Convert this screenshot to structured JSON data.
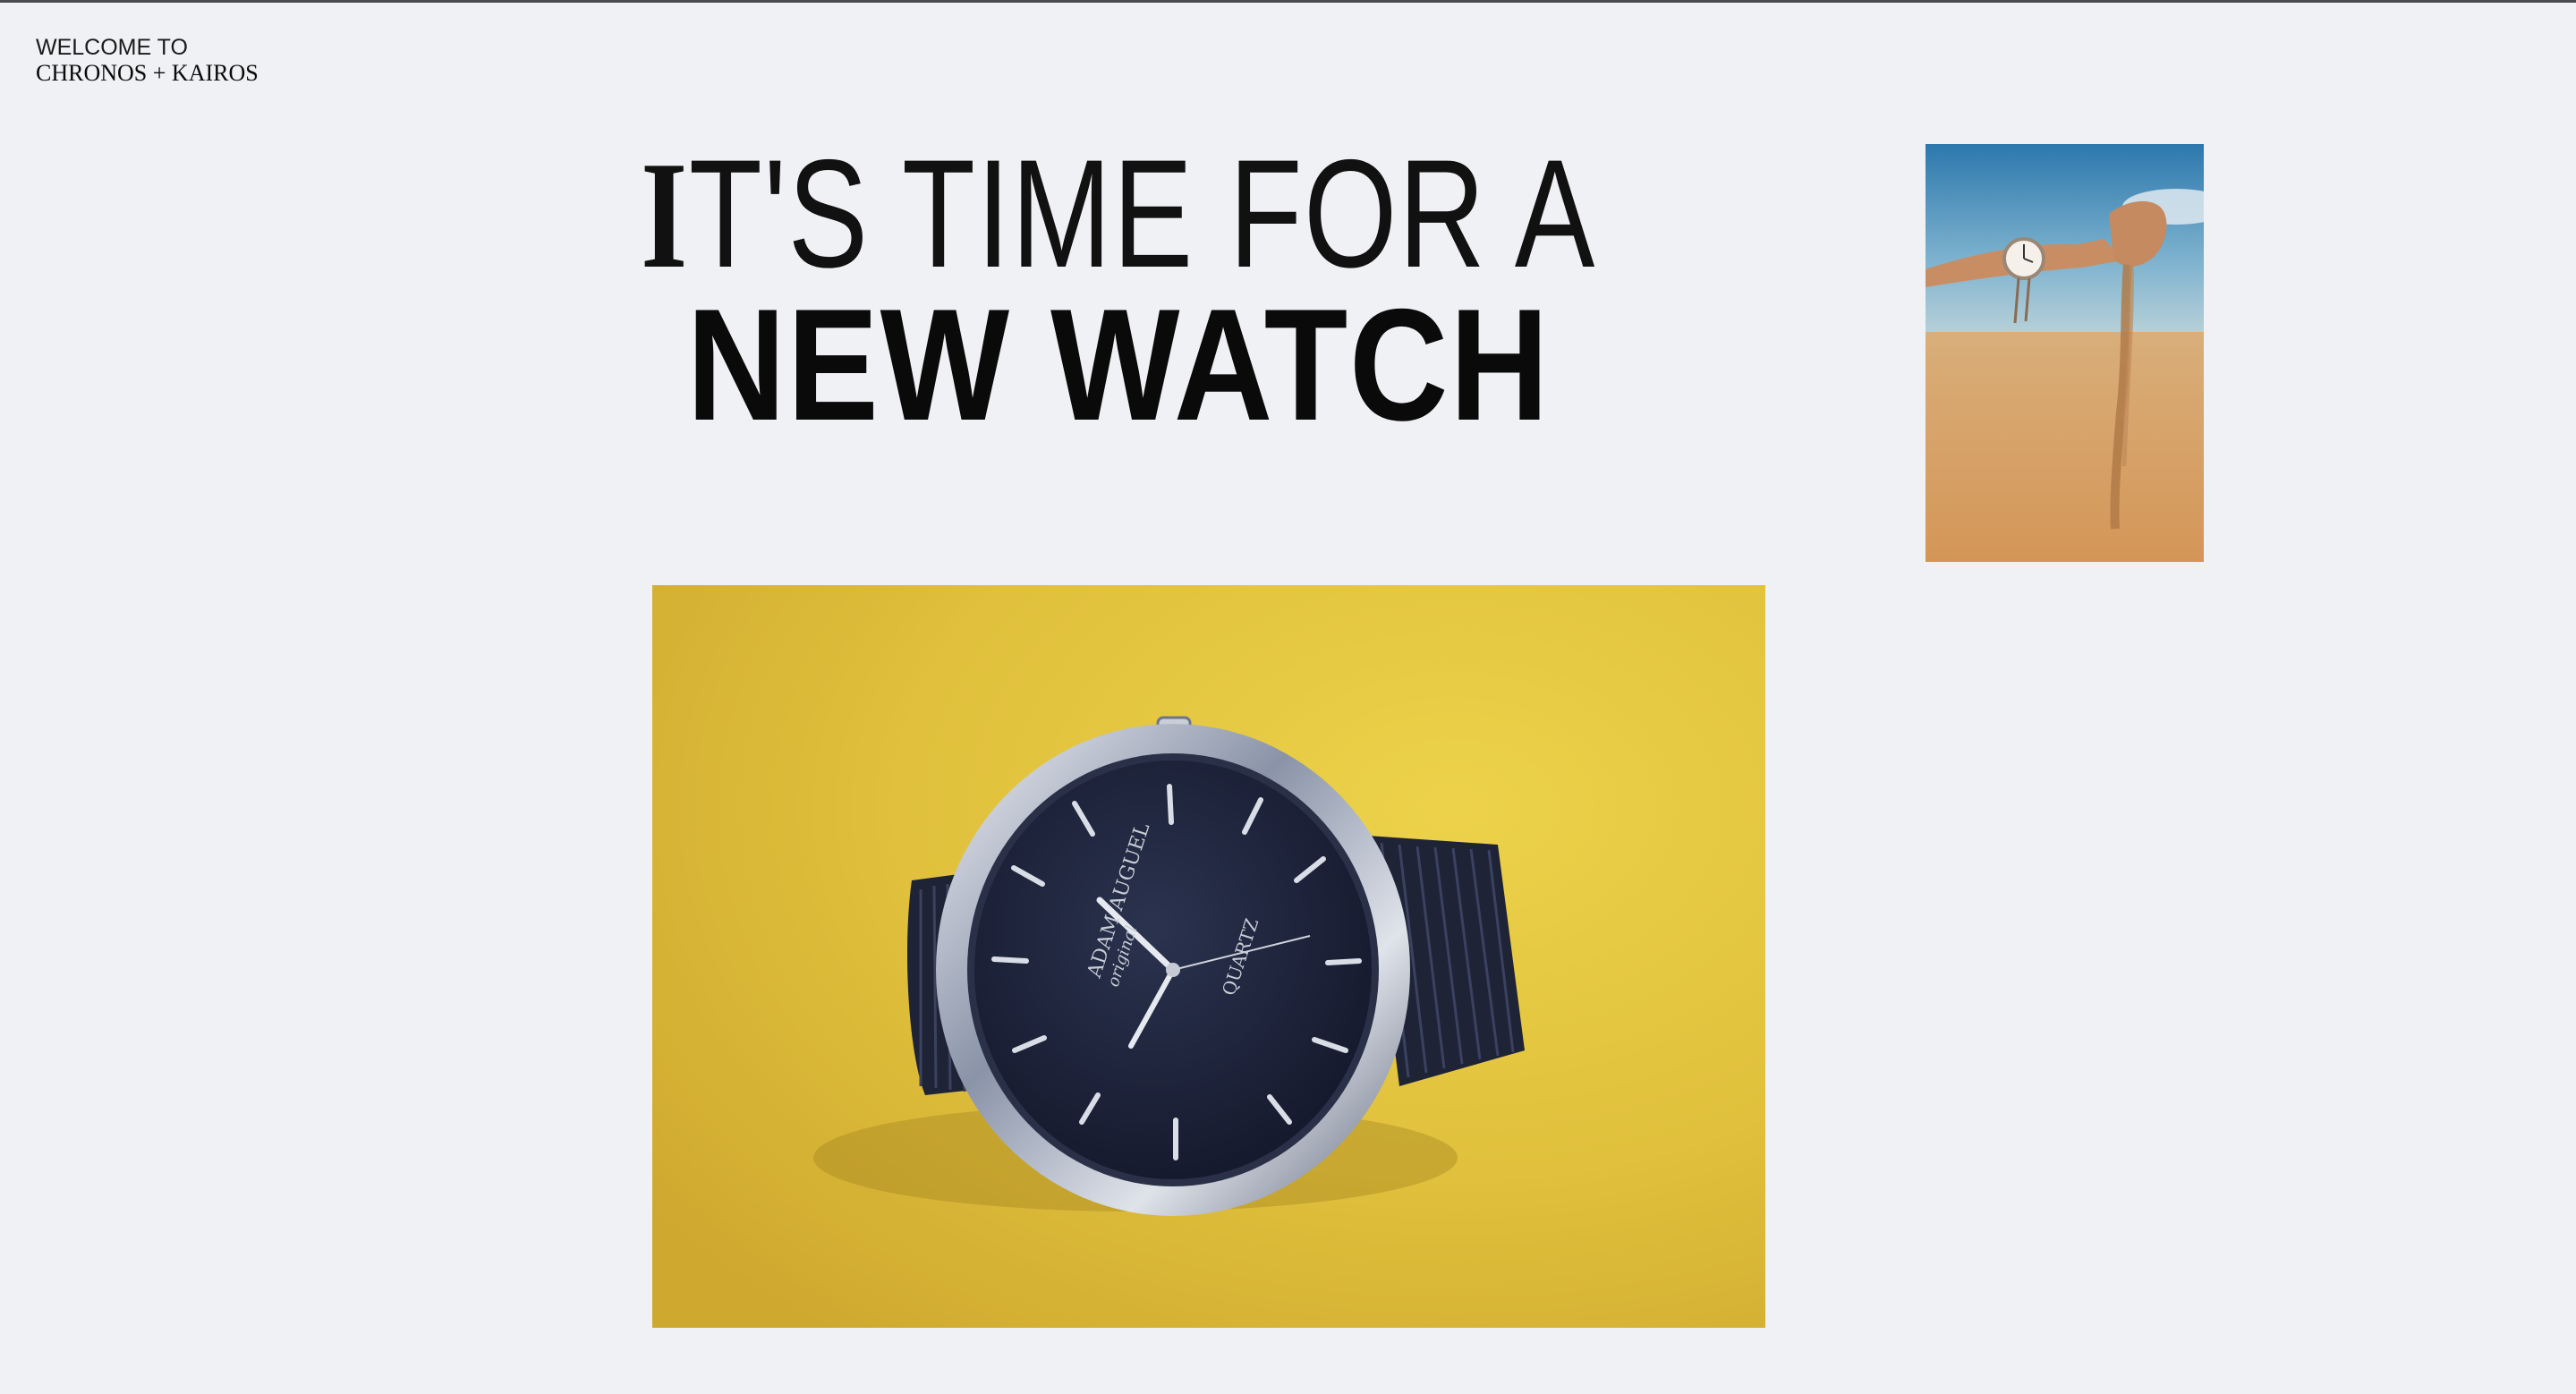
{
  "brand": {
    "welcome": "WELCOME TO",
    "name": "CHRONOS + KAIROS"
  },
  "headline": {
    "line1_initial": "I",
    "line1_rest": "T'S TIME FOR A",
    "line2": "NEW WATCH"
  },
  "images": {
    "hero": {
      "subject": "wristwatch with dark blue dial on yellow background",
      "dial_brand": "ADAM AUGUEL",
      "dial_sub": "original",
      "dial_movement": "QUARTZ"
    },
    "thumb": {
      "subject": "hand wearing watch pouring sand in desert"
    }
  },
  "colors": {
    "background": "#f0f1f4",
    "text": "#0d0d0d",
    "hero_yellow": "#e3c53f",
    "dial_blue": "#1c2238"
  },
  "icons": []
}
